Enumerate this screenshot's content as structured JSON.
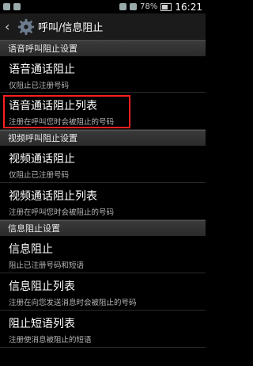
{
  "status": {
    "battery": "78%",
    "time": "16:21"
  },
  "header": {
    "title": "呼叫/信息阻止"
  },
  "sections": [
    {
      "label": "语音呼叫阻止设置"
    },
    {
      "label": "视频呼叫阻止设置"
    },
    {
      "label": "信息阻止设置"
    }
  ],
  "items": [
    {
      "title": "语音通话阻止",
      "subtitle": "仅阻止已注册号码"
    },
    {
      "title": "语音通话阻止列表",
      "subtitle": "注册在呼叫您时会被阻止的号码"
    },
    {
      "title": "视频通话阻止",
      "subtitle": "仅阻止已注册号码"
    },
    {
      "title": "视频通话阻止列表",
      "subtitle": "注册在呼叫您时会被阻止的号码"
    },
    {
      "title": "信息阻止",
      "subtitle": "阻止已注册号码和短语"
    },
    {
      "title": "信息阻止列表",
      "subtitle": "注册在向您发送消息时会被阻止的号码"
    },
    {
      "title": "阻止短语列表",
      "subtitle": "注册使消息被阻止的短语"
    }
  ],
  "colors": {
    "highlight": "#ff1e1e"
  }
}
